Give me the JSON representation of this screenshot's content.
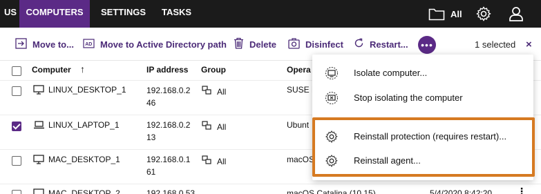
{
  "nav": {
    "tabs": [
      {
        "label": "US"
      },
      {
        "label": "COMPUTERS"
      },
      {
        "label": "SETTINGS"
      },
      {
        "label": "TASKS"
      }
    ],
    "folder_label": "All"
  },
  "toolbar": {
    "move_to": "Move to...",
    "move_ad": "Move to Active Directory path",
    "delete": "Delete",
    "disinfect": "Disinfect",
    "restart": "Restart...",
    "more": "•••",
    "selected": "1 selected",
    "close": "×"
  },
  "table": {
    "headers": {
      "computer": "Computer",
      "sort_arrow": "↑",
      "ip": "IP address",
      "group": "Group",
      "os": "Opera"
    },
    "rows": [
      {
        "name": "LINUX_DESKTOP_1",
        "ip": "192.168.0.246",
        "group": "All",
        "os": "SUSE L",
        "date": "",
        "checked": false
      },
      {
        "name": "LINUX_LAPTOP_1",
        "ip": "192.168.0.213",
        "group": "All",
        "os": "Ubunt",
        "date": "",
        "checked": true
      },
      {
        "name": "MAC_DESKTOP_1",
        "ip": "192.168.0.161",
        "group": "All",
        "os": "macOS",
        "date": "",
        "checked": false
      },
      {
        "name": "MAC_DESKTOP_2",
        "ip": "192.168.0.53",
        "group": "All",
        "os": "macOS Catalina (10.15)",
        "date": "5/4/2020 8:42:20",
        "checked": false
      }
    ]
  },
  "menu": {
    "items": [
      {
        "label": "Isolate computer..."
      },
      {
        "label": "Stop isolating the computer"
      },
      {
        "label": "Reinstall protection (requires restart)..."
      },
      {
        "label": "Reinstall agent..."
      }
    ]
  },
  "colors": {
    "nav_bg": "#1b1b1b",
    "accent": "#5b2a86",
    "highlight": "#d67a22"
  }
}
